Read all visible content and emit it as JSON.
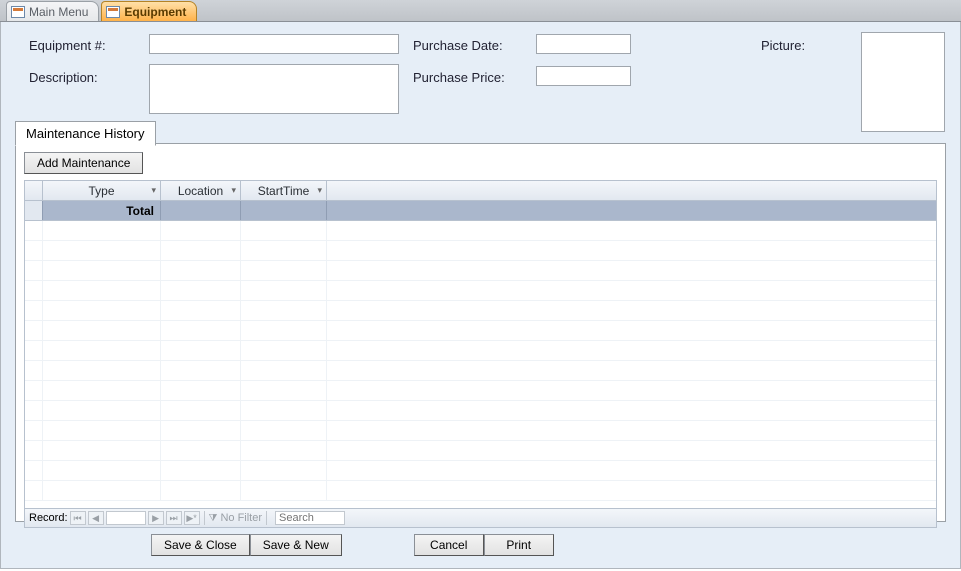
{
  "tabs": {
    "main_menu": "Main Menu",
    "equipment": "Equipment"
  },
  "fields": {
    "equipment_num_label": "Equipment #:",
    "equipment_num_value": "",
    "description_label": "Description:",
    "description_value": "",
    "purchase_date_label": "Purchase Date:",
    "purchase_date_value": "",
    "purchase_price_label": "Purchase Price:",
    "purchase_price_value": "",
    "picture_label": "Picture:"
  },
  "subtab": {
    "label": "Maintenance History"
  },
  "subform": {
    "add_button": "Add Maintenance",
    "columns": {
      "type": "Type",
      "location": "Location",
      "start_time": "StartTime"
    },
    "total_label": "Total"
  },
  "record_nav": {
    "label": "Record:",
    "no_filter": "No Filter",
    "search_placeholder": "Search"
  },
  "buttons": {
    "save_close": "Save & Close",
    "save_new": "Save & New",
    "cancel": "Cancel",
    "print": "Print"
  }
}
